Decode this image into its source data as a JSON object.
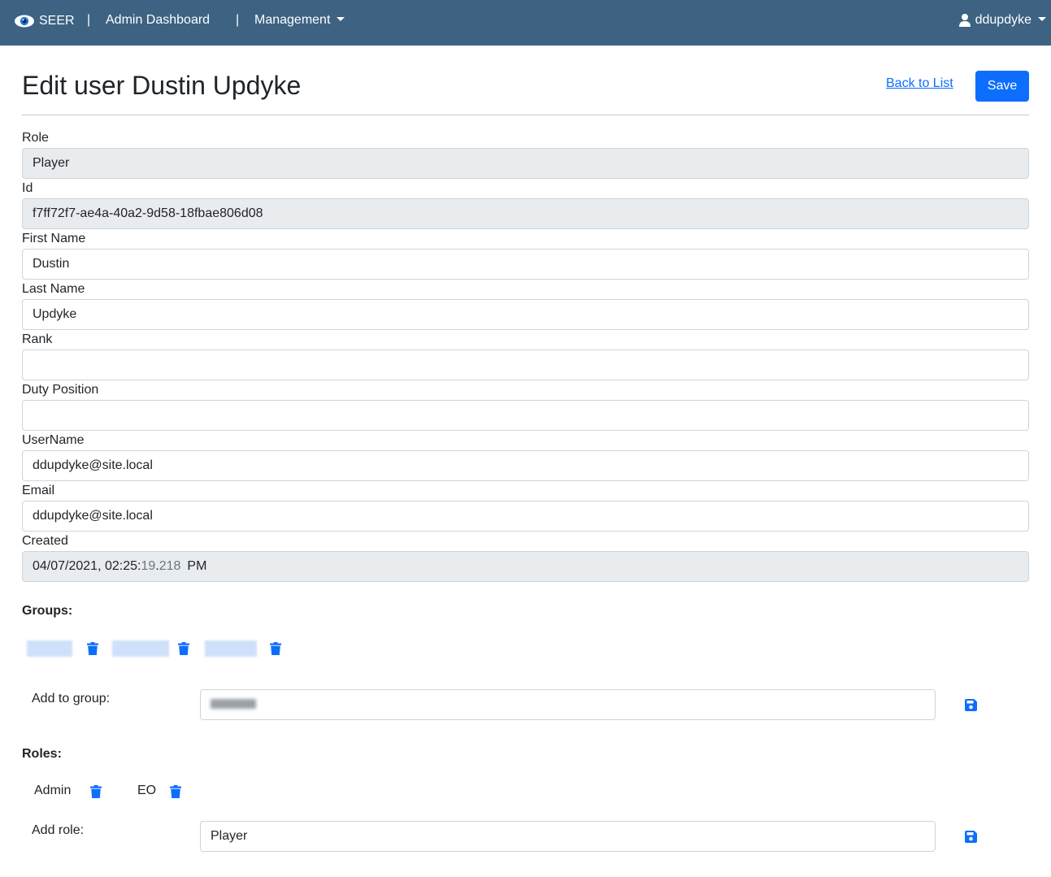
{
  "navbar": {
    "brand": "SEER",
    "brand_icon": "eye-icon",
    "separator": "|",
    "admin_link": "Admin Dashboard",
    "management_link": "Management",
    "user": "ddupdyke",
    "user_icon": "user-icon",
    "background": "#3d6282"
  },
  "header": {
    "title": "Edit user Dustin Updyke",
    "back_link": "Back to List",
    "save_label": "Save",
    "accent": "#0d6efd"
  },
  "form": {
    "role": {
      "label": "Role",
      "value": "Player"
    },
    "id": {
      "label": "Id",
      "value": "f7ff72f7-ae4a-40a2-9d58-18fbae806d08"
    },
    "first_name": {
      "label": "First Name",
      "value": "Dustin"
    },
    "last_name": {
      "label": "Last Name",
      "value": "Updyke"
    },
    "rank": {
      "label": "Rank",
      "value": ""
    },
    "duty_position": {
      "label": "Duty Position",
      "value": ""
    },
    "username": {
      "label": "UserName",
      "value": "ddupdyke@site.local"
    },
    "email": {
      "label": "Email",
      "value": "ddupdyke@site.local"
    },
    "created": {
      "label": "Created",
      "date_part": "04/07/2021, 02:25:",
      "seconds": "19",
      "dot": ".",
      "millis": "218",
      "ampm": "PM"
    }
  },
  "groups": {
    "heading": "Groups:",
    "add_label": "Add to group:",
    "delete_icon": "trash-icon",
    "save_icon": "floppy-disk-icon"
  },
  "roles": {
    "heading": "Roles:",
    "items": [
      "Admin",
      "EO"
    ],
    "add_label": "Add role:",
    "add_value": "Player",
    "delete_icon": "trash-icon",
    "save_icon": "floppy-disk-icon"
  }
}
